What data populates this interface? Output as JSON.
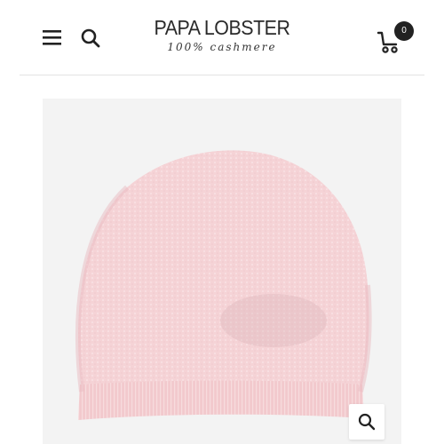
{
  "header": {
    "logo": {
      "name": "PAPA LOBSTER",
      "tagline": "100% cashmere"
    },
    "menu_icon": "hamburger-menu-icon",
    "search_icon": "search-icon",
    "cart": {
      "icon": "shopping-cart-icon",
      "count": "0"
    }
  },
  "product": {
    "image": "pink-cashmere-beanie",
    "hat_color": "#f5d3d6",
    "zoom_icon": "zoom-icon"
  },
  "colors": {
    "text": "#222222",
    "divider": "#e3e3e3",
    "image_background": "#f3f3f3"
  }
}
